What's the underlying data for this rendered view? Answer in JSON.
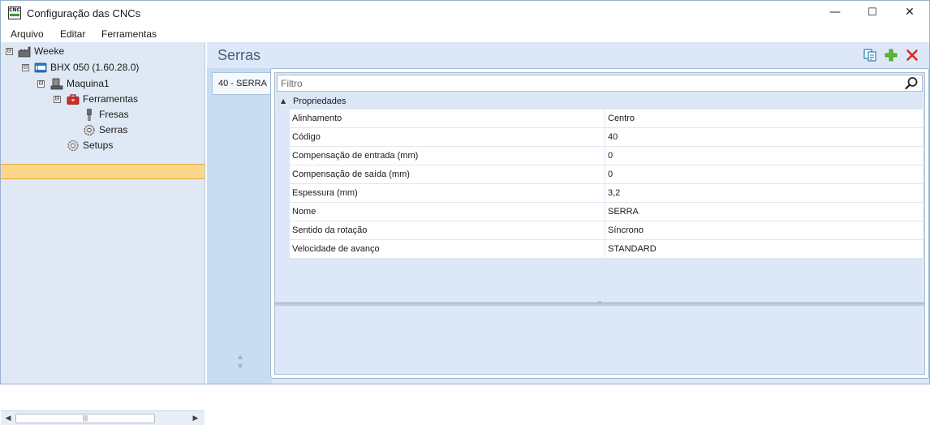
{
  "window": {
    "title": "Configuração das CNCs",
    "app_icon_text": "CNC"
  },
  "controls": {
    "minimize": "—",
    "maximize": "☐",
    "close": "✕"
  },
  "menu": {
    "items": [
      "Arquivo",
      "Editar",
      "Ferramentas"
    ]
  },
  "tree": {
    "nodes": [
      {
        "label": "Weeke",
        "icon": "factory-icon",
        "expander": "⊟"
      },
      {
        "label": "BHX 050 (1.60.28.0)",
        "icon": "cnc-machine-icon",
        "expander": "⊟"
      },
      {
        "label": "Maquina1",
        "icon": "machine-icon",
        "expander": "⊟"
      },
      {
        "label": "Ferramentas",
        "icon": "toolbox-icon",
        "expander": "⊟"
      },
      {
        "label": "Fresas",
        "icon": "drill-bit-icon"
      },
      {
        "label": "Serras",
        "icon": "saw-gear-icon",
        "selected": true
      },
      {
        "label": "Setups",
        "icon": "gear-icon"
      }
    ]
  },
  "panel": {
    "title": "Serras",
    "toolbar": {
      "copy_icon": "copy-icon",
      "add_icon": "add-icon",
      "delete_icon": "delete-icon"
    },
    "tabs": [
      {
        "label": "40 - SERRA"
      }
    ],
    "filter": {
      "placeholder": "Filtro",
      "value": ""
    },
    "group": {
      "label": "Propriedades",
      "collapse_icon": "▲"
    },
    "properties": [
      {
        "name": "Alinhamento",
        "value": "Centro"
      },
      {
        "name": "Código",
        "value": "40"
      },
      {
        "name": "Compensação de entrada (mm)",
        "value": "0"
      },
      {
        "name": "Compensação de saída (mm)",
        "value": "0"
      },
      {
        "name": "Espessura (mm)",
        "value": "3,2"
      },
      {
        "name": "Nome",
        "value": "SERRA"
      },
      {
        "name": "Sentido da rotação",
        "value": "Síncrono"
      },
      {
        "name": "Velocidade de avanço",
        "value": "STANDARD"
      }
    ]
  },
  "colors": {
    "selection": "#fcd68b",
    "panel_bg": "#dce8f7",
    "title_text": "#4a5f7a",
    "add_green": "#5cb82e",
    "delete_red": "#e02424"
  }
}
